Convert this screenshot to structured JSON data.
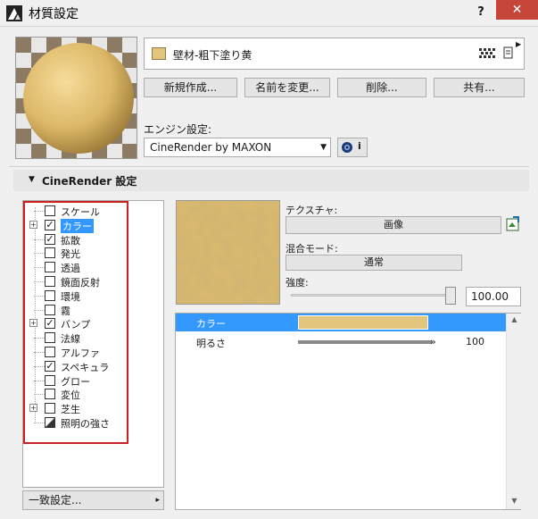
{
  "window": {
    "title": "材質設定",
    "help_label": "?",
    "close_label": "✕",
    "app_icon": "archicad-icon"
  },
  "material": {
    "name": "壁材-粗下塗り黄",
    "swatch_color": "#e3c67e"
  },
  "buttons": {
    "new": "新規作成...",
    "rename": "名前を変更...",
    "delete": "削除...",
    "share": "共有..."
  },
  "engine": {
    "label": "エンジン設定:",
    "selected": "CineRender by MAXON",
    "info_label": "i"
  },
  "section": {
    "title": "CineRender 設定"
  },
  "channels": [
    {
      "label": "スケール",
      "checked": false,
      "expandable": false,
      "selected": false
    },
    {
      "label": "カラー",
      "checked": true,
      "expandable": true,
      "selected": true
    },
    {
      "label": "拡散",
      "checked": true,
      "expandable": false,
      "selected": false
    },
    {
      "label": "発光",
      "checked": false,
      "expandable": false,
      "selected": false
    },
    {
      "label": "透過",
      "checked": false,
      "expandable": false,
      "selected": false
    },
    {
      "label": "鏡面反射",
      "checked": false,
      "expandable": false,
      "selected": false
    },
    {
      "label": "環境",
      "checked": false,
      "expandable": false,
      "selected": false
    },
    {
      "label": "霧",
      "checked": false,
      "expandable": false,
      "selected": false
    },
    {
      "label": "バンプ",
      "checked": true,
      "expandable": true,
      "selected": false
    },
    {
      "label": "法線",
      "checked": false,
      "expandable": false,
      "selected": false
    },
    {
      "label": "アルファ",
      "checked": false,
      "expandable": false,
      "selected": false
    },
    {
      "label": "スペキュラ",
      "checked": true,
      "expandable": false,
      "selected": false
    },
    {
      "label": "グロー",
      "checked": false,
      "expandable": false,
      "selected": false
    },
    {
      "label": "変位",
      "checked": false,
      "expandable": false,
      "selected": false
    },
    {
      "label": "芝生",
      "checked": false,
      "expandable": true,
      "selected": false
    },
    {
      "label": "照明の強さ",
      "checked": false,
      "expandable": false,
      "selected": false
    }
  ],
  "consistency": {
    "label": "一致設定..."
  },
  "texture": {
    "label": "テクスチャ:",
    "button": "画像"
  },
  "blend": {
    "label": "混合モード:",
    "value": "通常"
  },
  "strength": {
    "label": "強度:",
    "value": "100.00",
    "fraction": 1.0
  },
  "properties": [
    {
      "label": "カラー",
      "color": "#e3c67e"
    },
    {
      "label": "明るさ",
      "value": "100"
    }
  ]
}
